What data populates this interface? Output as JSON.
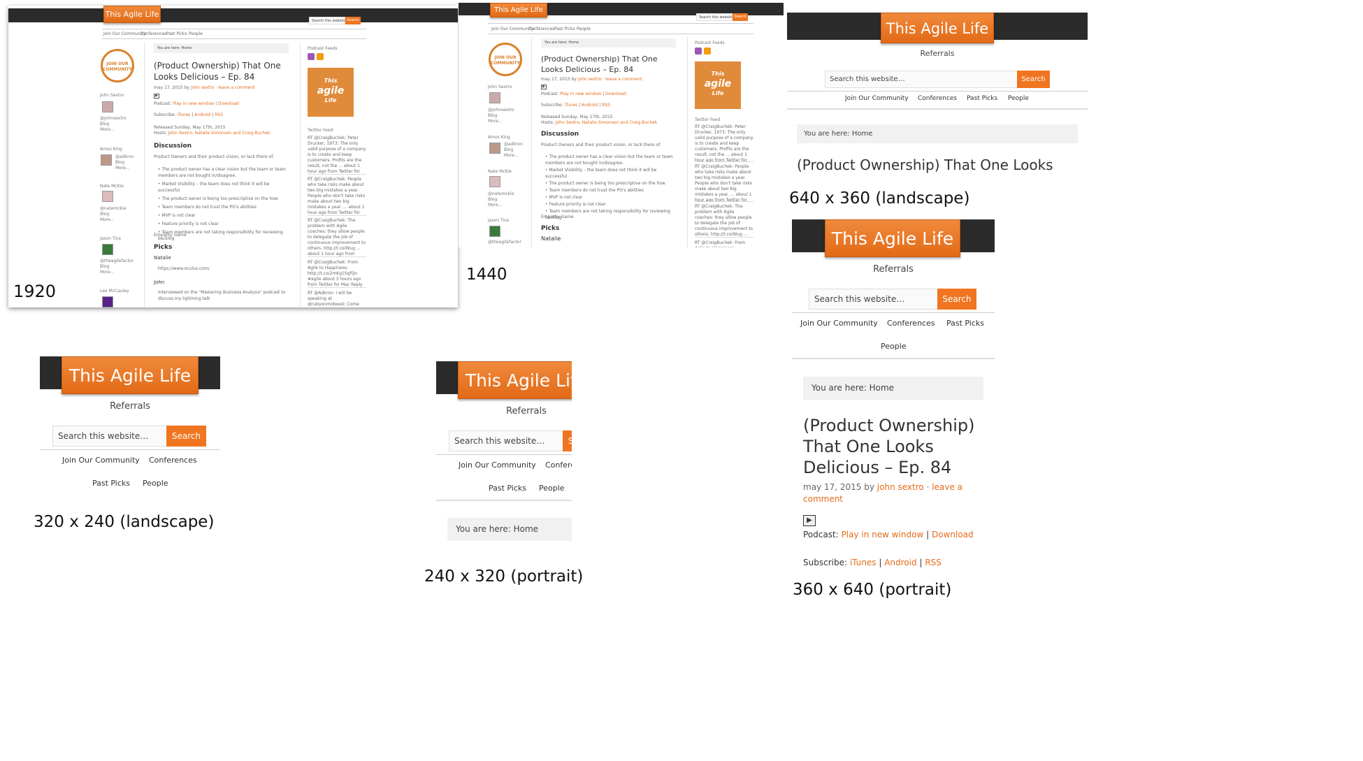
{
  "site": {
    "title": "This Agile Life",
    "referrals": "Referrals",
    "search_placeholder": "Search this website…",
    "search_button": "Search",
    "nav": [
      "Join Our Community",
      "Conferences",
      "Past Picks",
      "People"
    ],
    "breadcrumb": "You are here: Home"
  },
  "post": {
    "title": "(Product Ownership) That One Looks Delicious – Ep. 84",
    "title_line1": "(Product Ownership)",
    "title_line2": "That One Looks",
    "title_line3": "Delicious – Ep. 84",
    "title_wide_line1": "(Product Ownership) That One",
    "title_wide_line2": "Looks Delicious – Ep. 84",
    "title_landscape": "(Product Ownership) That One Looks",
    "meta_date": "may 17, 2015",
    "meta_by": "by",
    "meta_author": "john sextro",
    "meta_sep": "·",
    "meta_comment_1": "leave a",
    "meta_comment_2": "comment",
    "meta_comment": "leave a comment",
    "podcast_label": "Podcast:",
    "play_link": "Play in new window",
    "download_link": "Download",
    "subscribe_label": "Subscribe:",
    "itunes": "iTunes",
    "android": "Android",
    "rss": "RSS",
    "pipe": "|",
    "released": "Released Sunday, May 17th, 2015",
    "hosts_label": "Hosts:",
    "hosts": "John Sextro, Natalie Simonsen and Craig Buchek",
    "discussion": "Discussion",
    "discussion_intro": "Product Owners and their product vision, or lack there of.",
    "bullets": [
      "The product owner has a clear vision but the team or team members are not bought in/disagree.",
      "Market Visibility – the team does not think it will be successful",
      "The product owner is being too prescriptive on the how",
      "Team members do not trust the PO's abilities",
      "MVP is not clear",
      "Feature priority is not clear",
      "Team members are not taking responsibility for reviewing backlog"
    ],
    "empathy": "Empathy Game",
    "picks": "Picks",
    "natalie": "Natalie",
    "oculus": "https://www.oculus.com/",
    "john": "John",
    "john_pick": "Interviewed on the \"Mastering Business Analysis\" podcast to discuss my lightning talk"
  },
  "sidebar_left": {
    "seal_text": "JOIN OUR COMMUNITY",
    "people": [
      {
        "name": "John Sextro",
        "links": [
          "@johnsextro",
          "Blog",
          "More..."
        ]
      },
      {
        "name": "Amos King",
        "links": [
          "@adkron",
          "Blog",
          "More..."
        ]
      },
      {
        "name": "Nate McKie",
        "links": [
          "@natemckie",
          "Blog",
          "More..."
        ]
      },
      {
        "name": "Jason Tice",
        "links": [
          "@theagilefactor",
          "Blog",
          "More..."
        ]
      },
      {
        "name": "Lee McCauley",
        "links": []
      }
    ]
  },
  "sidebar_right": {
    "podcast_feeds": "Podcast Feeds",
    "logo_line1": "This",
    "logo_line2": "agile",
    "logo_line3": "Life",
    "twitter_feed": "Twitter Feed",
    "tweets": [
      "RT @CraigBuchek: Peter Drucker, 1973: The only valid purpose of a company is to create and keep customers. Profits are the result, not the ... about 1 hour ago from Twitter for Mac Reply Retweet Favorite",
      "RT @CraigBuchek: People who take risks make about two big mistakes a year. People who don't take risks make about two big mistakes a year. ... about 1 hour ago from Twitter for Mac Reply Retweet Favorite",
      "RT @CraigBuchek: The problem with Agile coaches: they allow people to delegate the job of continuous improvement to others. http://t.co/Wug ... about 1 hour ago from Twitter for Mac Reply Retweet Favorite",
      "RT @CraigBuchek: From Agile to Happiness: http://t.co/2mKg1SgfQn #agile about 3 hours ago from Twitter for Mac Reply Retweet Favorite",
      "RT @Adkron: I will be speaking at @rubyonmidwest: Come and enjoy"
    ]
  },
  "labels": {
    "w1920": "1920",
    "w1440": "1440",
    "l640": "640 x 360 (landscape)",
    "l320": "320 x 240 (landscape)",
    "p240": "240 x 320 (portrait)",
    "p360": "360 x 640 (portrait)"
  },
  "colors": {
    "accent": "#e46b1a",
    "button": "#f07520",
    "header_bar": "#2b2b2b",
    "breadcrumb_bg": "#f1f1f1"
  }
}
